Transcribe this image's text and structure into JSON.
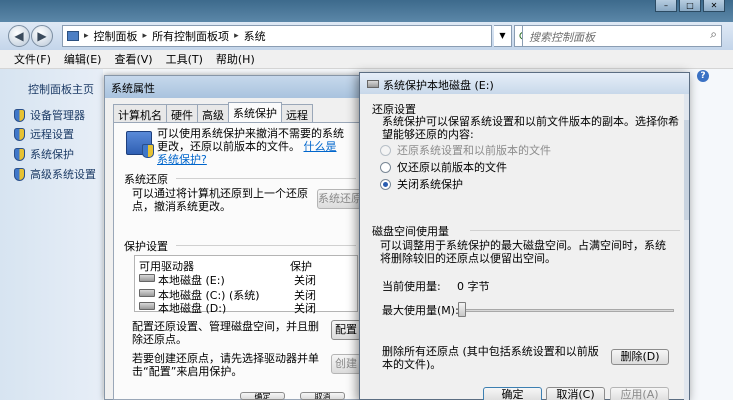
{
  "explorer": {
    "breadcrumb": [
      "控制面板",
      "所有控制面板项",
      "系统"
    ],
    "search_placeholder": "搜索控制面板",
    "menu": [
      "文件(F)",
      "编辑(E)",
      "查看(V)",
      "工具(T)",
      "帮助(H)"
    ],
    "sidebar_home": "控制面板主页",
    "sidebar_items": [
      "设备管理器",
      "远程设置",
      "系统保护",
      "高级系统设置"
    ]
  },
  "system_properties": {
    "title": "系统属性",
    "tabs": [
      "计算机名",
      "硬件",
      "高级",
      "系统保护",
      "远程"
    ],
    "active_tab": "系统保护",
    "intro_text": "可以使用系统保护来撤消不需要的系统更改，还原以前版本的文件。",
    "intro_link": "什么是系统保护?",
    "restore_section": "系统还原",
    "restore_desc": "可以通过将计算机还原到上一个还原点，撤消系统更改。",
    "restore_button": "系统还原",
    "protection_section": "保护设置",
    "col_drive": "可用驱动器",
    "col_protection": "保护",
    "drives": [
      {
        "name": "本地磁盘 (E:)",
        "protection": "关闭"
      },
      {
        "name": "本地磁盘 (C:) (系统)",
        "protection": "关闭"
      },
      {
        "name": "本地磁盘 (D:)",
        "protection": "关闭"
      }
    ],
    "configure_desc": "配置还原设置、管理磁盘空间，并且删除还原点。",
    "configure_button": "配置",
    "create_desc": "若要创建还原点，请先选择驱动器并单击“配置”来启用保护。",
    "create_button": "创建",
    "ok_button": "确定",
    "cancel_button": "取消"
  },
  "disk_protection": {
    "title": "系统保护本地磁盘 (E:)",
    "restore_title": "还原设置",
    "restore_text": "系统保护可以保留系统设置和以前文件版本的副本。选择你希望能够还原的内容:",
    "options": [
      {
        "label": "还原系统设置和以前版本的文件",
        "state": "disabled"
      },
      {
        "label": "仅还原以前版本的文件",
        "state": "unchecked"
      },
      {
        "label": "关闭系统保护",
        "state": "checked"
      }
    ],
    "disk_title": "磁盘空间使用量",
    "disk_text": "可以调整用于系统保护的最大磁盘空间。占满空间时，系统将删除较旧的还原点以便留出空间。",
    "current_usage_label": "当前使用量:",
    "current_usage_value": "0 字节",
    "max_usage_label": "最大使用量(M):",
    "max_usage_fraction": 0,
    "delete_text": "删除所有还原点 (其中包括系统设置和以前版本的文件)。",
    "delete_button": "删除(D)",
    "ok_button": "确定",
    "cancel_button": "取消(C)",
    "apply_button": "应用(A)"
  }
}
